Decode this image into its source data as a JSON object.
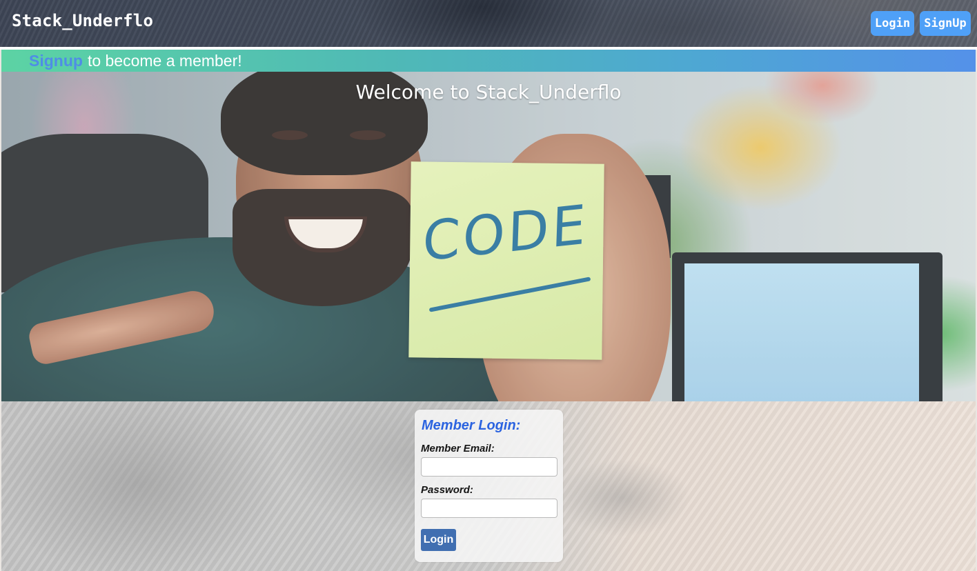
{
  "header": {
    "brand": "Stack_Underflo",
    "login_label": "Login",
    "signup_label": "SignUp"
  },
  "banner": {
    "link_text": "Signup",
    "rest_text": "to become a member!"
  },
  "hero": {
    "title": "Welcome to Stack_Underflo",
    "postit_text": "CODE"
  },
  "login_form": {
    "title": "Member Login:",
    "email_label": "Member Email:",
    "email_value": "",
    "password_label": "Password:",
    "password_value": "",
    "submit_label": "Login"
  },
  "colors": {
    "nav_button": "#4fa0f7",
    "banner_link": "#4f8de6",
    "login_title": "#2b63e0",
    "submit_button": "#416fb1"
  }
}
